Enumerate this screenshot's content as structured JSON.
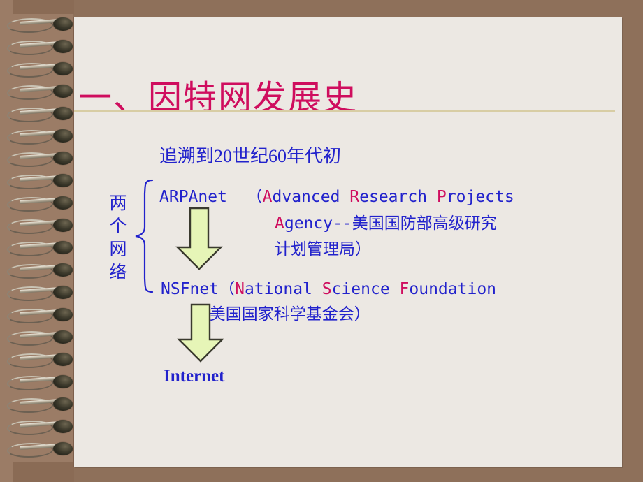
{
  "slide": {
    "title": "一、因特网发展史",
    "subtitle": "追溯到20世纪60年代初",
    "vertical_label": "两个网络",
    "brace_glyph": "{",
    "networks": [
      {
        "name": "ARPAnet",
        "open_paren": "（",
        "expansion_line1": [
          {
            "text": "A",
            "accent": true
          },
          {
            "text": "dvanced ",
            "accent": false
          },
          {
            "text": "R",
            "accent": true
          },
          {
            "text": "esearch ",
            "accent": false
          },
          {
            "text": "P",
            "accent": true
          },
          {
            "text": "rojects",
            "accent": false
          }
        ],
        "expansion_line2": [
          {
            "text": "A",
            "accent": true
          },
          {
            "text": "gency--",
            "accent": false
          }
        ],
        "chinese_line2": "美国国防部高级研究",
        "chinese_line3": "计划管理局）"
      },
      {
        "name": "NSFnet",
        "open_paren": "（",
        "expansion_line1": [
          {
            "text": "N",
            "accent": true
          },
          {
            "text": "ational ",
            "accent": false
          },
          {
            "text": "S",
            "accent": true
          },
          {
            "text": "cience ",
            "accent": false
          },
          {
            "text": "F",
            "accent": true
          },
          {
            "text": "oundation",
            "accent": false
          }
        ],
        "chinese_line2": "--美国国家科学基金会）"
      }
    ],
    "result": "Internet",
    "colors": {
      "accent_pink": "#cf0d5e",
      "text_blue": "#2222cc",
      "page_bg": "#ece8e3",
      "binder_brown": "#8e705a",
      "rule_tan": "#d8cda4",
      "arrow_fill": "#e6f5b7",
      "arrow_stroke": "#3a3a2e"
    },
    "arrows": [
      {
        "name": "arpanet-to-nsfnet-arrow"
      },
      {
        "name": "nsfnet-to-internet-arrow"
      }
    ],
    "spiral_ring_count": 20
  }
}
